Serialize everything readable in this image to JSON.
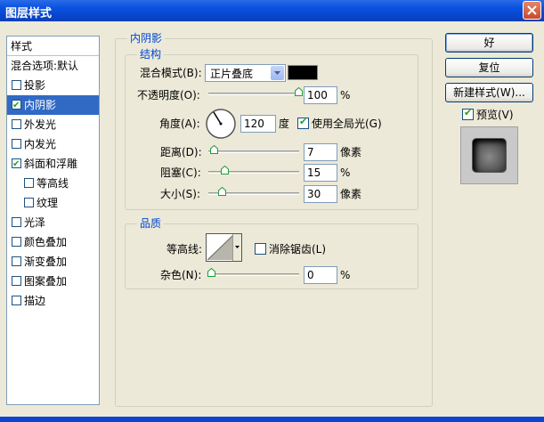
{
  "window": {
    "title": "图层样式"
  },
  "sidebar": {
    "items": [
      {
        "label": "样式",
        "checkbox": false
      },
      {
        "label": "混合选项:默认",
        "checkbox": false
      },
      {
        "label": "投影",
        "checkbox": true,
        "checked": false
      },
      {
        "label": "内阴影",
        "checkbox": true,
        "checked": true,
        "selected": true
      },
      {
        "label": "外发光",
        "checkbox": true,
        "checked": false
      },
      {
        "label": "内发光",
        "checkbox": true,
        "checked": false
      },
      {
        "label": "斜面和浮雕",
        "checkbox": true,
        "checked": true
      },
      {
        "label": "等高线",
        "checkbox": true,
        "checked": false,
        "indent": true
      },
      {
        "label": "纹理",
        "checkbox": true,
        "checked": false,
        "indent": true
      },
      {
        "label": "光泽",
        "checkbox": true,
        "checked": false
      },
      {
        "label": "颜色叠加",
        "checkbox": true,
        "checked": false
      },
      {
        "label": "渐变叠加",
        "checkbox": true,
        "checked": false
      },
      {
        "label": "图案叠加",
        "checkbox": true,
        "checked": false
      },
      {
        "label": "描边",
        "checkbox": true,
        "checked": false
      }
    ]
  },
  "panel": {
    "title": "内阴影",
    "structure": {
      "title": "结构",
      "blend_mode_label": "混合模式(B):",
      "blend_mode_value": "正片叠底",
      "blend_color": "#000000",
      "opacity_label": "不透明度(O):",
      "opacity_value": "100",
      "opacity_unit": "%",
      "opacity_level": 1.0,
      "angle_label": "角度(A):",
      "angle_value": "120",
      "angle_unit": "度",
      "global_light_label": "使用全局光(G)",
      "global_light_checked": true,
      "distance_label": "距离(D):",
      "distance_value": "7",
      "distance_unit": "像素",
      "distance_level": 0.03,
      "choke_label": "阻塞(C):",
      "choke_value": "15",
      "choke_unit": "%",
      "choke_level": 0.15,
      "size_label": "大小(S):",
      "size_value": "30",
      "size_unit": "像素",
      "size_level": 0.12
    },
    "quality": {
      "title": "品质",
      "contour_label": "等高线:",
      "anti_alias_label": "消除锯齿(L)",
      "anti_alias_checked": false,
      "noise_label": "杂色(N):",
      "noise_value": "0",
      "noise_unit": "%",
      "noise_level": 0.0
    }
  },
  "buttons": {
    "ok": "好",
    "reset": "复位",
    "new_style": "新建样式(W)...",
    "preview_label": "预览(V)",
    "preview_checked": true
  }
}
